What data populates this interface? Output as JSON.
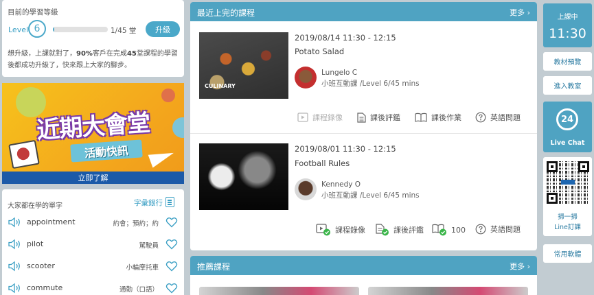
{
  "level": {
    "title": "目前的學習等級",
    "label": "Level",
    "value": "6",
    "progress_text": "1/45 堂",
    "progress_fraction": 0.022,
    "upgrade_label": "升級",
    "desc_prefix": "想升級，上課就對了，",
    "desc_bold": "90%",
    "desc_mid": "客戶在完成",
    "desc_bold2": "45",
    "desc_suffix": "堂課程的學習後都成功升級了，快來跟上大家的腳步。"
  },
  "banner": {
    "title": "近期大會堂",
    "ribbon": "活動快訊",
    "cta": "立即了解"
  },
  "words": {
    "title": "大家都在學的單字",
    "bank_label": "字彙銀行",
    "items": [
      {
        "en": "appointment",
        "zh": "約會；預約；約"
      },
      {
        "en": "pilot",
        "zh": "駕駛員"
      },
      {
        "en": "scooter",
        "zh": "小輪摩托車"
      },
      {
        "en": "commute",
        "zh": "通勤（口語）"
      }
    ]
  },
  "recent": {
    "title": "最近上完的課程",
    "more": "更多",
    "courses": [
      {
        "date": "2019/08/14 11:30 - 12:15",
        "name": "Potato Salad",
        "teacher": "Lungelo C",
        "meta": "小班互動課 /Level 6/45 mins",
        "image_caption": "CULINARY",
        "actions": [
          "課程錄像",
          "課後評鑑",
          "課後作業",
          "英語問題"
        ]
      },
      {
        "date": "2019/08/01 11:30 - 12:15",
        "name": "Football Rules",
        "teacher": "Kennedy O",
        "meta": "小班互動課 /Level 6/45 mins",
        "actions": [
          "課程錄像",
          "課後評鑑",
          "100",
          "英語問題"
        ]
      }
    ]
  },
  "recommend": {
    "title": "推薦課程",
    "more": "更多"
  },
  "right": {
    "start_label": "上課中",
    "start_time": "11:30",
    "materials": "教材預覽",
    "enter_class": "進入教室",
    "live_number": "24",
    "live_label": "Live Chat",
    "qr_line1": "掃一掃",
    "qr_line2": "Line訂課",
    "software": "常用軟體"
  },
  "colors": {
    "accent": "#4fa3c2",
    "check": "#3bb54a",
    "banner_bg": "#f6c21c",
    "banner_cta": "#1b5aa8"
  }
}
